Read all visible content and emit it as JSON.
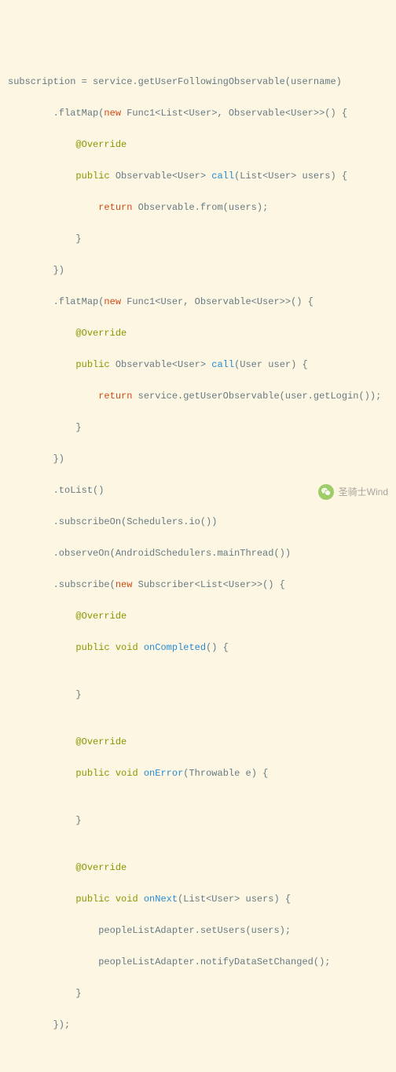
{
  "code": {
    "l01a": "subscription = service.getUserFollowingObservable(username)",
    "l02a": "        .flatMap(",
    "l02b": "new",
    "l02c": " Func1<List<User>, Observable<User>>() {",
    "l03a": "            ",
    "l03b": "@Override",
    "l04a": "            ",
    "l04b": "public",
    "l04c": " Observable<User> ",
    "l04d": "call",
    "l04e": "(List<User> users) {",
    "l05a": "                ",
    "l05b": "return",
    "l05c": " Observable.from(users);",
    "l06a": "            }",
    "l07a": "        })",
    "l08a": "        .flatMap(",
    "l08b": "new",
    "l08c": " Func1<User, Observable<User>>() {",
    "l09a": "            ",
    "l09b": "@Override",
    "l10a": "            ",
    "l10b": "public",
    "l10c": " Observable<User> ",
    "l10d": "call",
    "l10e": "(User user) {",
    "l11a": "                ",
    "l11b": "return",
    "l11c": " service.getUserObservable(user.getLogin());",
    "l12a": "            }",
    "l13a": "        })",
    "l14a": "        .toList()",
    "l15a": "        .subscribeOn(Schedulers.io())",
    "l16a": "        .observeOn(AndroidSchedulers.mainThread())",
    "l17a": "        .subscribe(",
    "l17b": "new",
    "l17c": " Subscriber<List<User>>() {",
    "l18a": "            ",
    "l18b": "@Override",
    "l19a": "            ",
    "l19b": "public",
    "l19c": " ",
    "l19d": "void",
    "l19e": " ",
    "l19f": "onCompleted",
    "l19g": "() {",
    "l20a": "",
    "l21a": "            }",
    "l22a": "",
    "l23a": "            ",
    "l23b": "@Override",
    "l24a": "            ",
    "l24b": "public",
    "l24c": " ",
    "l24d": "void",
    "l24e": " ",
    "l24f": "onError",
    "l24g": "(Throwable e) {",
    "l25a": "",
    "l26a": "            }",
    "l27a": "",
    "l28a": "            ",
    "l28b": "@Override",
    "l29a": "            ",
    "l29b": "public",
    "l29c": " ",
    "l29d": "void",
    "l29e": " ",
    "l29f": "onNext",
    "l29g": "(List<User> users) {",
    "l30a": "                peopleListAdapter.setUsers(users);",
    "l31a": "                peopleListAdapter.notifyDataSetChanged();",
    "l32a": "            }",
    "l33a": "        });"
  },
  "watermark": {
    "text": "圣骑士Wind"
  }
}
